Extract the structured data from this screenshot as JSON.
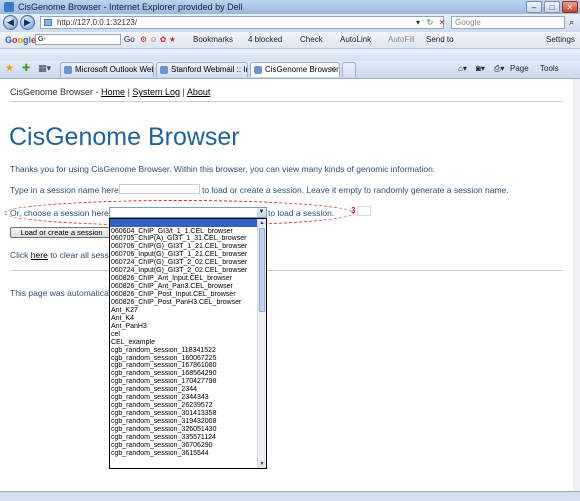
{
  "window": {
    "title": "CisGenome Browser - Internet Explorer provided by Dell"
  },
  "nav": {
    "url": "http://127.0.0.1:32123/",
    "search_placeholder": "Google"
  },
  "google_toolbar": {
    "logo": "Google",
    "search_value": "G-",
    "go_label": "Go",
    "bookmarks_label": "Bookmarks",
    "blocked_label": "4 blocked",
    "check_label": "Check",
    "autolink_label": "AutoLink",
    "autofill_label": "AutoFill",
    "sendto_label": "Send to",
    "settings_label": "Settings"
  },
  "tabs": [
    {
      "label": "Microsoft Outlook Web Ac..."
    },
    {
      "label": "Stanford Webmail :: Inbox ..."
    },
    {
      "label": "CisGenome Browser"
    }
  ],
  "command_bar": {
    "page_label": "Page",
    "tools_label": "Tools"
  },
  "page": {
    "breadcrumb_prefix": "CisGenome Browser -",
    "nav_home": "Home",
    "sep1": "|",
    "nav_system_log": "System Log",
    "sep2": "|",
    "nav_about": "About",
    "heading": "CisGenome Browser",
    "intro": "Thanks you for using CisGenome Browser. Within this browser, you can view many kinds of genomic information.",
    "type_session_prefix": "Type in a session name here:",
    "type_session_suffix": "to load or create a session. Leave it empty to randomly generate a session name.",
    "choose_prefix": "Or, choose a session here:",
    "choose_suffix": "to load a session.",
    "marker": "3",
    "button_label": "Load or create a session",
    "click_prefix": "Click",
    "click_link": "here",
    "click_suffix": "to clear all sessions.",
    "footer_text": "This page was automatically generated by CisGenome Browser."
  },
  "session_options": [
    "060604_ChIP_GI3/t_1_1.CEL_browser",
    "060705_ChIP(A)_GI3T_1_31.CEL_browser",
    "060706_ChIP(G)_GI3T_1_21.CEL_browser",
    "060706_Input(G)_GI3T_1_21.CEL_browser",
    "060724_ChIP(G)_GI3T_2_02.CEL_browser",
    "060724_Input(G)_GI3T_2_02.CEL_browser",
    "060826_ChIP_Ant_Input.CEL_browser",
    "060826_ChIP_Ant_Pan3.CEL_browser",
    "060826_ChIP_Post_Input.CEL_browser",
    "060826_ChIP_Post_PanH3.CEL_browser",
    "Ant_K27",
    "Ant_K4",
    "Ant_PanH3",
    "cel",
    "CEL_example",
    "cgb_random_session_118341522",
    "cgb_random_session_160067225",
    "cgb_random_session_167861080",
    "cgb_random_session_168564290",
    "cgb_random_session_170427798",
    "cgb_random_session_2344",
    "cgb_random_session_2344343",
    "cgb_random_session_26239572",
    "cgb_random_session_301413358",
    "cgb_random_session_319432008",
    "cgb_random_session_326051430",
    "cgb_random_session_335571124",
    "cgb_random_session_36706290",
    "cgb_random_session_3615544"
  ]
}
